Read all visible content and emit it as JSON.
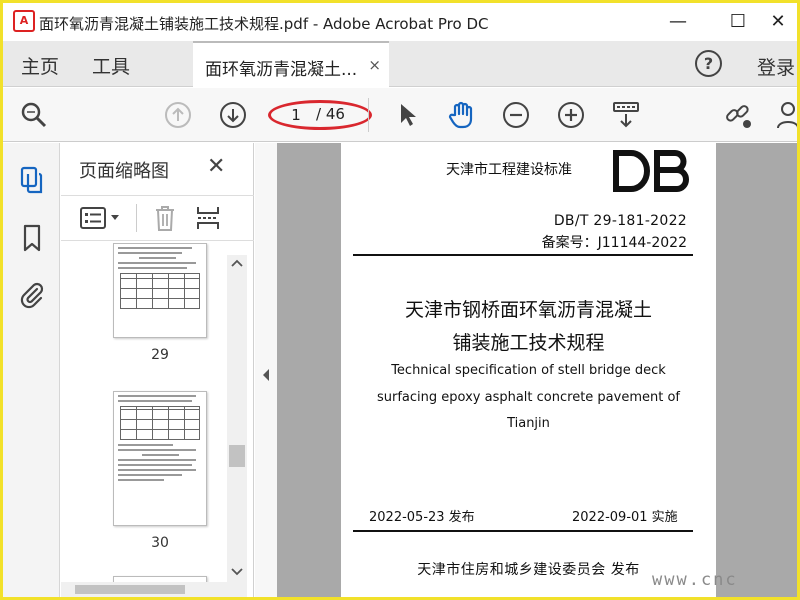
{
  "window": {
    "title": "面环氧沥青混凝土铺装施工技术规程.pdf - Adobe Acrobat Pro DC",
    "minimize": "—",
    "maximize": "☐",
    "close": "✕"
  },
  "tabs": {
    "home": "主页",
    "tools": "工具",
    "document_tab": "面环氧沥青混凝土...",
    "document_tab_close": "×",
    "help": "?",
    "login": "登录"
  },
  "toolbar": {
    "current_page": "1",
    "total_pages": "/ 46"
  },
  "thumbnail_panel": {
    "title": "页面缩略图",
    "close": "✕",
    "thumbnails": [
      {
        "page": "29"
      },
      {
        "page": "30"
      }
    ]
  },
  "document": {
    "standard_label": "天津市工程建设标准",
    "logo_text": "DB",
    "standard_number": "DB/T 29-181-2022",
    "record_number": "备案号：J11144-2022",
    "title_cn_line1": "天津市钢桥面环氧沥青混凝土",
    "title_cn_line2": "铺装施工技术规程",
    "title_en_line1": "Technical specification of stell bridge deck",
    "title_en_line2": "surfacing epoxy asphalt concrete pavement of",
    "title_en_line3": "Tianjin",
    "publish_date": "2022-05-23 发布",
    "implement_date": "2022-09-01 实施",
    "issuer": "天津市住房和城乡建设委员会   发布"
  },
  "watermark": "www.cnc",
  "colors": {
    "highlight_ring": "#d9272e",
    "accent_blue": "#1565c0",
    "doc_background": "#a9a9a9",
    "frame": "#f2e12a"
  }
}
